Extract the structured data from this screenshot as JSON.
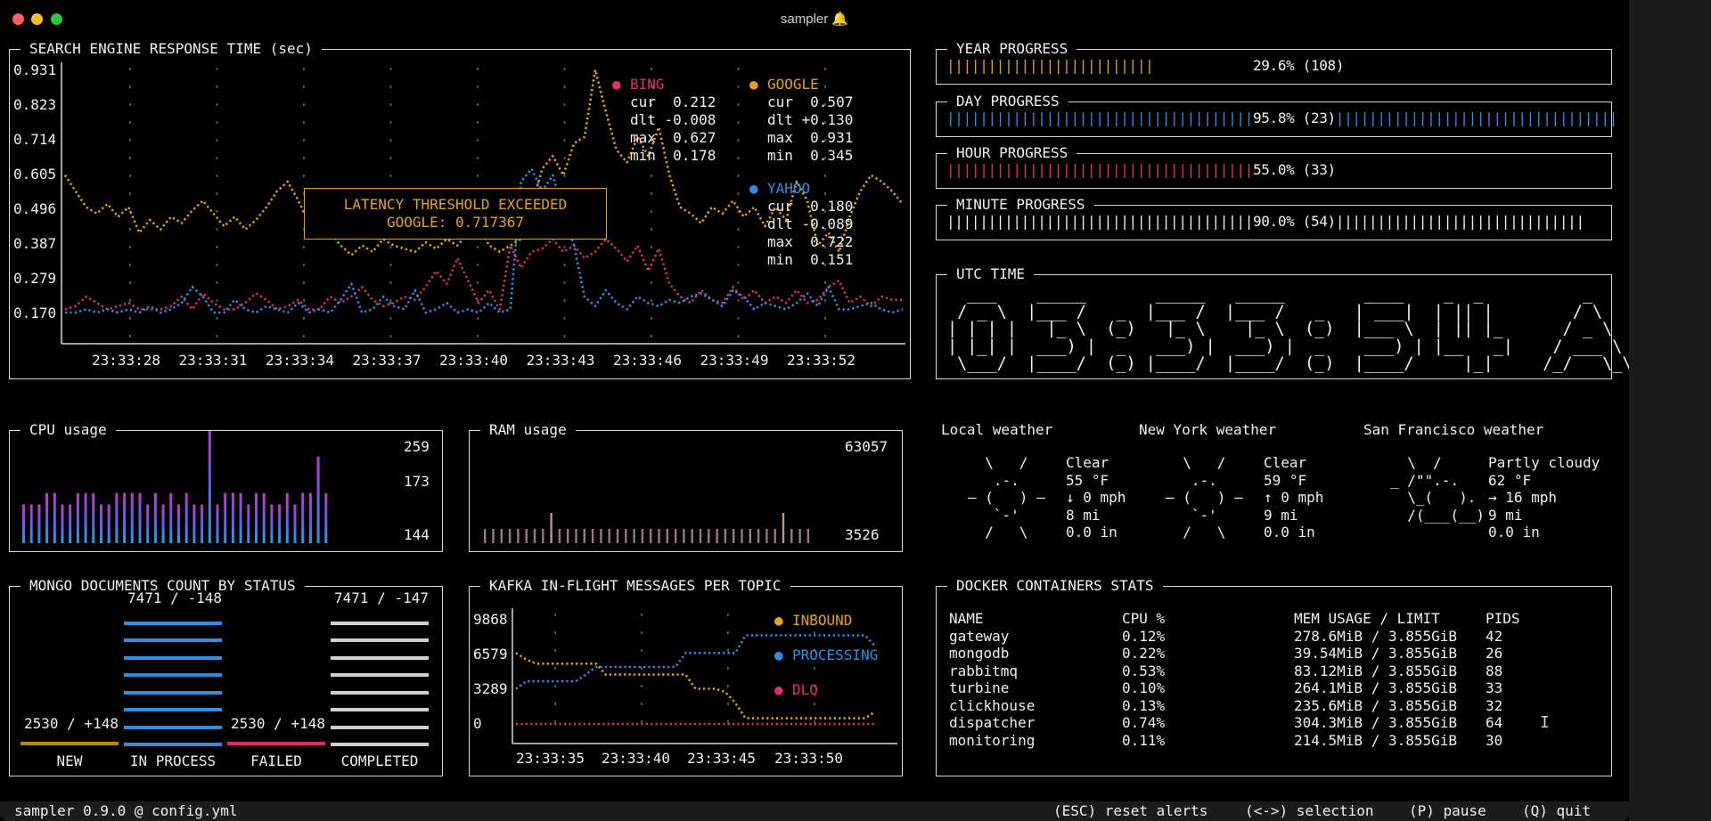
{
  "window": {
    "title": "sampler 🔔"
  },
  "search": {
    "title": "SEARCH ENGINE RESPONSE TIME (sec)",
    "yticks": [
      "0.931",
      "0.823",
      "0.714",
      "0.605",
      "0.496",
      "0.387",
      "0.279",
      "0.170"
    ],
    "xticks": [
      "23:33:28",
      "23:33:31",
      "23:33:34",
      "23:33:37",
      "23:33:40",
      "23:33:43",
      "23:33:46",
      "23:33:49",
      "23:33:52"
    ],
    "alert": {
      "line1": "LATENCY THRESHOLD EXCEEDED",
      "line2": "GOOGLE: 0.717367"
    },
    "legend": {
      "bing": {
        "name": "BING",
        "cur": "cur  0.212",
        "dlt": "dlt -0.008",
        "max": "max  0.627",
        "min": "min  0.178"
      },
      "google": {
        "name": "GOOGLE",
        "cur": "cur  0.507",
        "dlt": "dlt +0.130",
        "max": "max  0.931",
        "min": "min  0.345"
      },
      "yahoo": {
        "name": "YAHOO",
        "cur": "cur  0.180",
        "dlt": "dlt -0.089",
        "max": "max  0.722",
        "min": "min  0.151"
      }
    }
  },
  "progress": {
    "year": {
      "title": "YEAR PROGRESS",
      "label": "29.6% (108)",
      "value": 29.6
    },
    "day": {
      "title": "DAY PROGRESS",
      "label": "95.8% (23)",
      "value": 95.8
    },
    "hour": {
      "title": "HOUR PROGRESS",
      "label": "55.0% (33)",
      "value": 55.0
    },
    "minute": {
      "title": "MINUTE PROGRESS",
      "label": "90.0% (54)",
      "value": 90.0
    }
  },
  "utc": {
    "title": "UTC TIME",
    "time": "03:33:54 AM",
    "ascii": [
      "  ___    _____       _____   _____        ____    _  _          _       __  __",
      " / _ \\  |___ /   _  |___ /  |___ /   _   | ___|  | || |        / \\     |  \\/  |",
      "| | | |   |_ \\  (_)   |_ \\    |_ \\  (_)  |___ \\  | || |_      / _ \\    | |\\/| |",
      "| |_| |  ___) |  _   ___) |  ___) |  _    ___) | |__   _|    / ___ \\   | |  | |",
      " \\___/  |____/  (_) |____/  |____/  (_)  |____/     |_|     /_/   \\_\\  |_|  |_|"
    ]
  },
  "cpu": {
    "title": "CPU usage",
    "max": "259",
    "mid": "173",
    "min": "144"
  },
  "ram": {
    "title": "RAM usage",
    "max": "63057",
    "min": "3526"
  },
  "weather": [
    {
      "title": "Local weather",
      "art": [
        "  \\   /  ",
        "   .-.   ",
        "― (   ) ―",
        "   `-'   ",
        "  /   \\  "
      ],
      "lines": [
        "Clear",
        "55 °F",
        "↓ 0 mph",
        "8 mi",
        "0.0 in"
      ]
    },
    {
      "title": "New York weather",
      "art": [
        "  \\   /  ",
        "   .-.   ",
        "― (   ) ―",
        "   `-'   ",
        "  /   \\  "
      ],
      "lines": [
        "Clear",
        "59 °F",
        "↑ 0 mph",
        "9 mi",
        "0.0 in"
      ]
    },
    {
      "title": "San Francisco weather",
      "art": [
        "  \\  /    ",
        "_ /\"\".-.  ",
        "  \\_(   ). ",
        "  /(___(__)",
        "          "
      ],
      "lines": [
        "Partly cloudy",
        "62 °F",
        "→ 16 mph",
        "9 mi",
        "0.0 in"
      ]
    }
  ],
  "mongo": {
    "title": "MONGO DOCUMENTS COUNT BY STATUS",
    "bars": [
      {
        "label": "NEW",
        "value": "2530 / +148",
        "color": "#b8860b"
      },
      {
        "label": "IN PROCESS",
        "value": "7471 / -148",
        "color": "#2f8fe0"
      },
      {
        "label": "FAILED",
        "value": "2530 / +148",
        "color": "#d6316b"
      },
      {
        "label": "COMPLETED",
        "value": "7471 / -147",
        "color": "#d0d0d0"
      }
    ]
  },
  "kafka": {
    "title": "KAFKA IN-FLIGHT MESSAGES PER TOPIC",
    "yticks": [
      "9868",
      "6579",
      "3289",
      "0"
    ],
    "xticks": [
      "23:33:35",
      "23:33:40",
      "23:33:45",
      "23:33:50"
    ],
    "legend": [
      "INBOUND",
      "PROCESSING",
      "DLQ"
    ]
  },
  "docker": {
    "title": "DOCKER CONTAINERS STATS",
    "headers": [
      "NAME",
      "CPU %",
      "MEM USAGE / LIMIT",
      "PIDS"
    ],
    "rows": [
      [
        "gateway",
        "0.12%",
        "278.6MiB / 3.855GiB",
        "42"
      ],
      [
        "mongodb",
        "0.22%",
        "39.54MiB / 3.855GiB",
        "26"
      ],
      [
        "rabbitmq",
        "0.53%",
        "83.12MiB / 3.855GiB",
        "88"
      ],
      [
        "turbine",
        "0.10%",
        "264.1MiB / 3.855GiB",
        "33"
      ],
      [
        "clickhouse",
        "0.13%",
        "235.6MiB / 3.855GiB",
        "32"
      ],
      [
        "dispatcher",
        "0.74%",
        "304.3MiB / 3.855GiB",
        "64"
      ],
      [
        "monitoring",
        "0.11%",
        "214.5MiB / 3.855GiB",
        "30"
      ]
    ]
  },
  "statusbar": {
    "left": "sampler 0.9.0 @ config.yml",
    "esc": "(ESC) reset alerts",
    "sel": "(<->) selection",
    "pause": "(P) pause",
    "quit": "(Q) quit"
  },
  "colors": {
    "bing": "#e0306a",
    "google": "#e3a21a",
    "yahoo": "#2f8fe6",
    "border": "#d8d8d8"
  }
}
